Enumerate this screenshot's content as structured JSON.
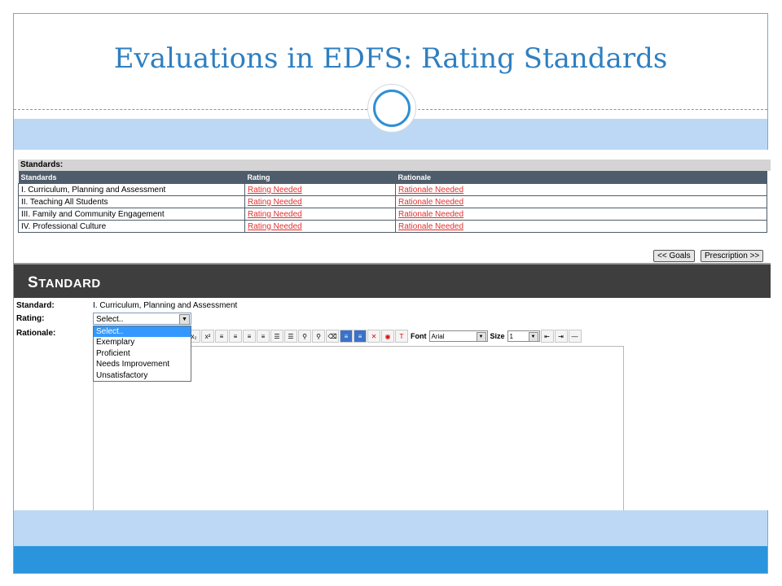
{
  "slide": {
    "title": "Evaluations in EDFS: Rating Standards"
  },
  "standards_panel": {
    "header": "Standards:",
    "columns": [
      "Standards",
      "Rating",
      "Rationale"
    ],
    "rows": [
      {
        "standard": "I. Curriculum, Planning and Assessment",
        "rating": "Rating Needed",
        "rationale": "Rationale Needed"
      },
      {
        "standard": "II. Teaching All Students",
        "rating": "Rating Needed",
        "rationale": "Rationale Needed"
      },
      {
        "standard": "III. Family and Community Engagement",
        "rating": "Rating Needed",
        "rationale": "Rationale Needed"
      },
      {
        "standard": "IV. Professional Culture",
        "rating": "Rating Needed",
        "rationale": "Rationale Needed"
      }
    ]
  },
  "nav": {
    "goals_label": "<< Goals",
    "prescription_label": "Prescription >>"
  },
  "standard_section": {
    "title_first": "S",
    "title_rest": "TANDARD",
    "standard_label": "Standard:",
    "standard_value": "I. Curriculum, Planning and Assessment",
    "rating_label": "Rating:",
    "rating_selected": "Select..",
    "rationale_label": "Rationale:",
    "rating_options": [
      "Select..",
      "Exemplary",
      "Proficient",
      "Needs Improvement",
      "Unsatisfactory"
    ]
  },
  "editor_toolbar": {
    "subscript": "x₂",
    "superscript": "x²",
    "font_label": "Font",
    "font_value": "Arial",
    "size_label": "Size",
    "size_value": "1",
    "text_color_glyph": "T"
  },
  "colors": {
    "title_blue": "#2f7fc1",
    "band_light": "#bcd8f5",
    "band_dark": "#2a95dd",
    "table_header": "#4e5c6b",
    "link_red": "#e0312e"
  }
}
